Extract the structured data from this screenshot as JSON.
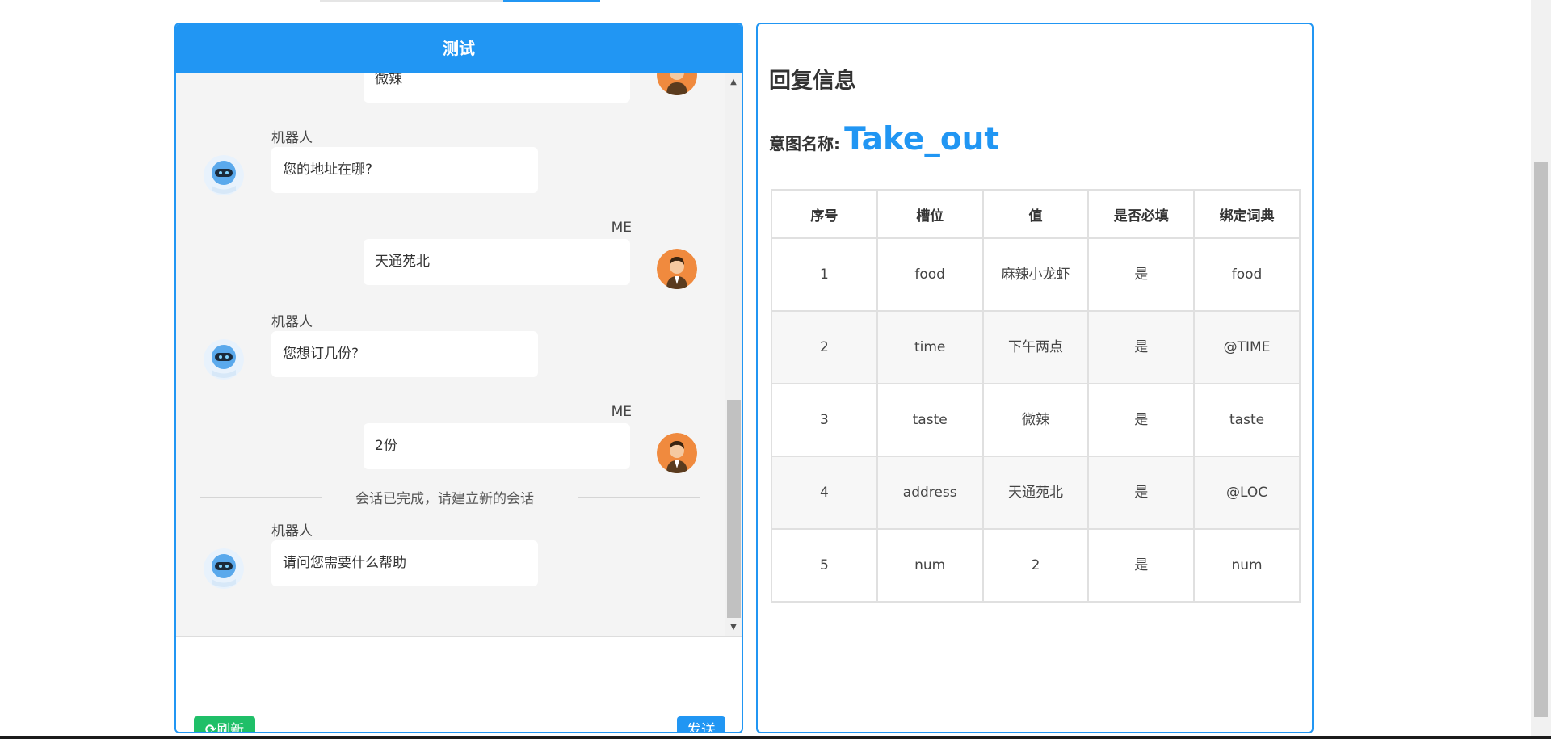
{
  "chat": {
    "title": "测试",
    "messages": [
      {
        "sender": "",
        "text": "微辣",
        "side": "right"
      },
      {
        "sender": "机器人",
        "text": "您的地址在哪?",
        "side": "left"
      },
      {
        "sender": "ME",
        "text": "天通苑北",
        "side": "right"
      },
      {
        "sender": "机器人",
        "text": "您想订几份?",
        "side": "left"
      },
      {
        "sender": "ME",
        "text": "2份",
        "side": "right"
      },
      {
        "sender": "机器人",
        "text": "请问您需要什么帮助",
        "side": "left"
      }
    ],
    "divider_text": "会话已完成，请建立新的会话",
    "refresh_label": "刷新",
    "send_label": "发送"
  },
  "reply": {
    "title": "回复信息",
    "intent_label": "意图名称:",
    "intent_name": "Take_out",
    "columns": [
      "序号",
      "槽位",
      "值",
      "是否必填",
      "绑定词典"
    ],
    "rows": [
      [
        "1",
        "food",
        "麻辣小龙虾",
        "是",
        "food"
      ],
      [
        "2",
        "time",
        "下午两点",
        "是",
        "@TIME"
      ],
      [
        "3",
        "taste",
        "微辣",
        "是",
        "taste"
      ],
      [
        "4",
        "address",
        "天通苑北",
        "是",
        "@LOC"
      ],
      [
        "5",
        "num",
        "2",
        "是",
        "num"
      ]
    ]
  },
  "colors": {
    "accent": "#2196f3",
    "refresh": "#1fbf68",
    "chat_bg": "#f4f4f4"
  },
  "icons": {
    "robot": "robot-avatar-icon",
    "user": "user-avatar-icon",
    "refresh": "refresh-icon",
    "scroll_up": "scroll-up-arrow-icon",
    "scroll_down": "scroll-down-arrow-icon"
  }
}
